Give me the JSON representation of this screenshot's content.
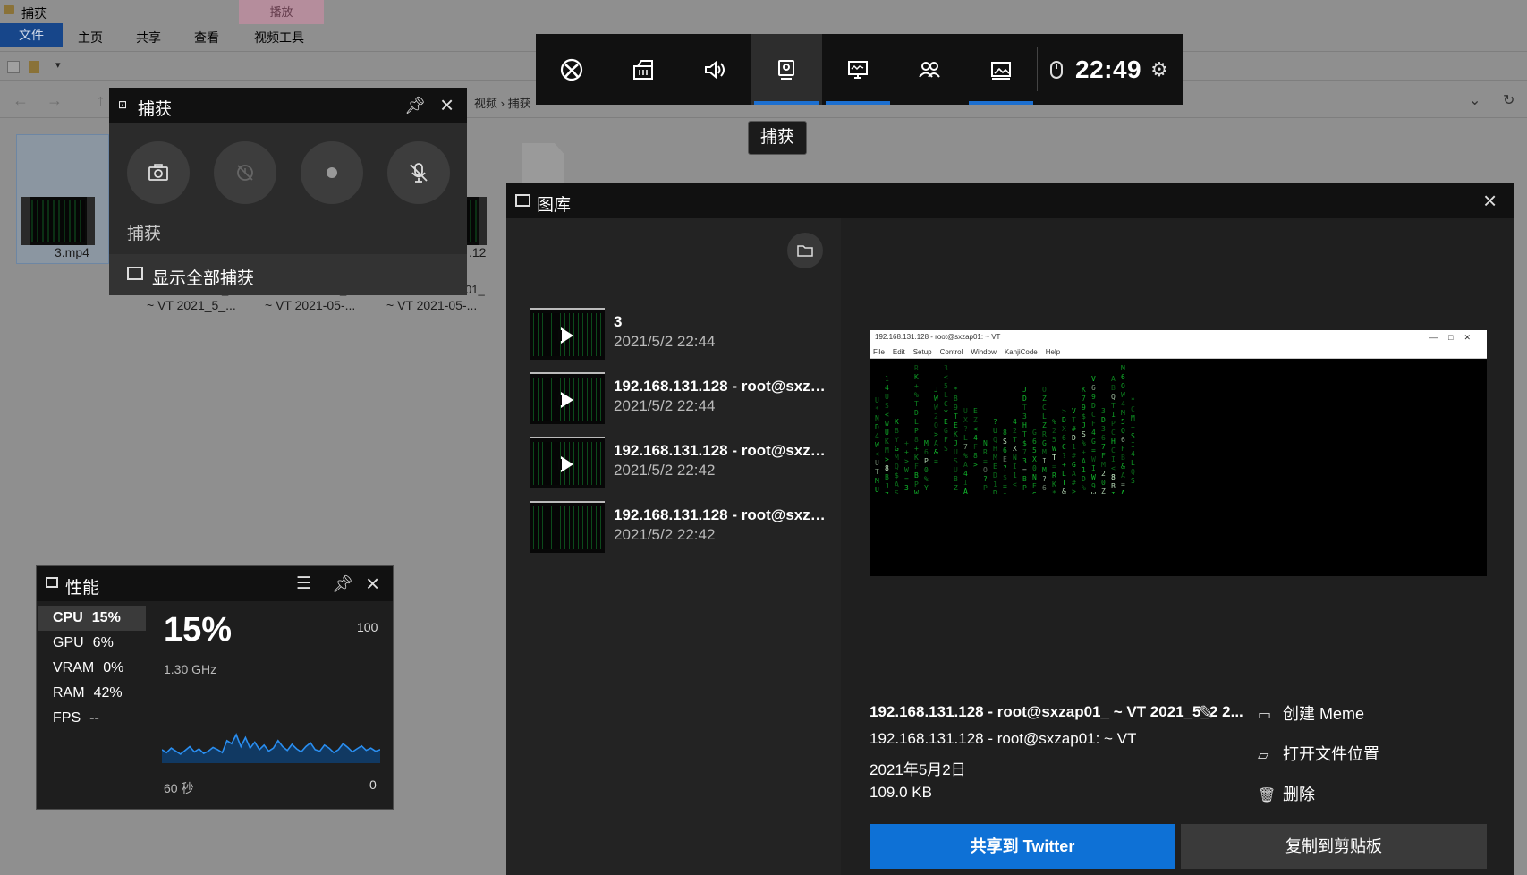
{
  "explorer": {
    "window_title": "捕获",
    "ribbon_tabs": [
      "文件",
      "主页",
      "共享",
      "查看",
      "视频工具"
    ],
    "contextual_tab": "播放",
    "breadcrumb": [
      "视频",
      "捕获"
    ],
    "files": [
      {
        "name": "3.mp4"
      },
      {
        "name": "~ VT 2021_5_..."
      },
      {
        "name": "~ VT 2021-05-..."
      },
      {
        "name": "~ VT 2021-05-..."
      }
    ],
    "file_fragments": [
      "_",
      "_",
      "01_",
      ".12"
    ]
  },
  "gamebar": {
    "buttons": [
      {
        "name": "xbox",
        "selected": false,
        "underline": false
      },
      {
        "name": "widget-menu",
        "selected": false,
        "underline": false
      },
      {
        "name": "audio",
        "selected": false,
        "underline": false
      },
      {
        "name": "capture",
        "selected": true,
        "underline": true
      },
      {
        "name": "performance",
        "selected": false,
        "underline": true
      },
      {
        "name": "social",
        "selected": false,
        "underline": false
      },
      {
        "name": "gallery",
        "selected": false,
        "underline": true
      }
    ],
    "time": "22:49",
    "tooltip": "捕获",
    "accent_color": "#1c6fd0"
  },
  "capture": {
    "title": "捕获",
    "label": "捕获",
    "show_all": "显示全部捕获"
  },
  "performance": {
    "title": "性能",
    "metrics": [
      {
        "name": "CPU",
        "value": "15%",
        "selected": true
      },
      {
        "name": "GPU",
        "value": "6%",
        "selected": false
      },
      {
        "name": "VRAM",
        "value": "0%",
        "selected": false
      },
      {
        "name": "RAM",
        "value": "42%",
        "selected": false
      },
      {
        "name": "FPS",
        "value": "--",
        "selected": false
      }
    ],
    "big_value": "15%",
    "frequency": "1.30 GHz",
    "axis_max": "100",
    "axis_min": "0",
    "duration": "60 秒",
    "graph_values": [
      18,
      14,
      20,
      16,
      12,
      17,
      22,
      15,
      19,
      13,
      16,
      21,
      18,
      14,
      30,
      26,
      38,
      22,
      34,
      20,
      28,
      18,
      24,
      16,
      20,
      30,
      22,
      17,
      25,
      19,
      15,
      22,
      27,
      18,
      16,
      24,
      20,
      14,
      18,
      26,
      21,
      15,
      19,
      23,
      17,
      20,
      16,
      18
    ]
  },
  "gallery": {
    "title": "图库",
    "items": [
      {
        "name": "3",
        "date": "2021/5/2 22:44",
        "is_video": true
      },
      {
        "name": "192.168.131.128 - root@sxzap...",
        "date": "2021/5/2 22:44",
        "is_video": true
      },
      {
        "name": "192.168.131.128 - root@sxzap...",
        "date": "2021/5/2 22:42",
        "is_video": true
      },
      {
        "name": "192.168.131.128 - root@sxzap...",
        "date": "2021/5/2 22:42",
        "is_video": false
      }
    ],
    "preview": {
      "window_title": "192.168.131.128 - root@sxzap01: ~ VT",
      "menu": [
        "File",
        "Edit",
        "Setup",
        "Control",
        "Window",
        "KanjiCode",
        "Help"
      ],
      "controls": [
        "—",
        "□",
        "✕"
      ],
      "rain_color": "#12c12e"
    },
    "detail": {
      "file_name": "192.168.131.128 - root@sxzap01_ ~ VT 2021_5_2 2...",
      "window_title": "192.168.131.128 - root@sxzap01: ~ VT",
      "date": "2021年5月2日",
      "size": "109.0 KB"
    },
    "actions": {
      "meme": "创建 Meme",
      "open_location": "打开文件位置",
      "delete": "删除"
    },
    "share_button": "共享到 Twitter",
    "copy_button": "复制到剪贴板"
  }
}
